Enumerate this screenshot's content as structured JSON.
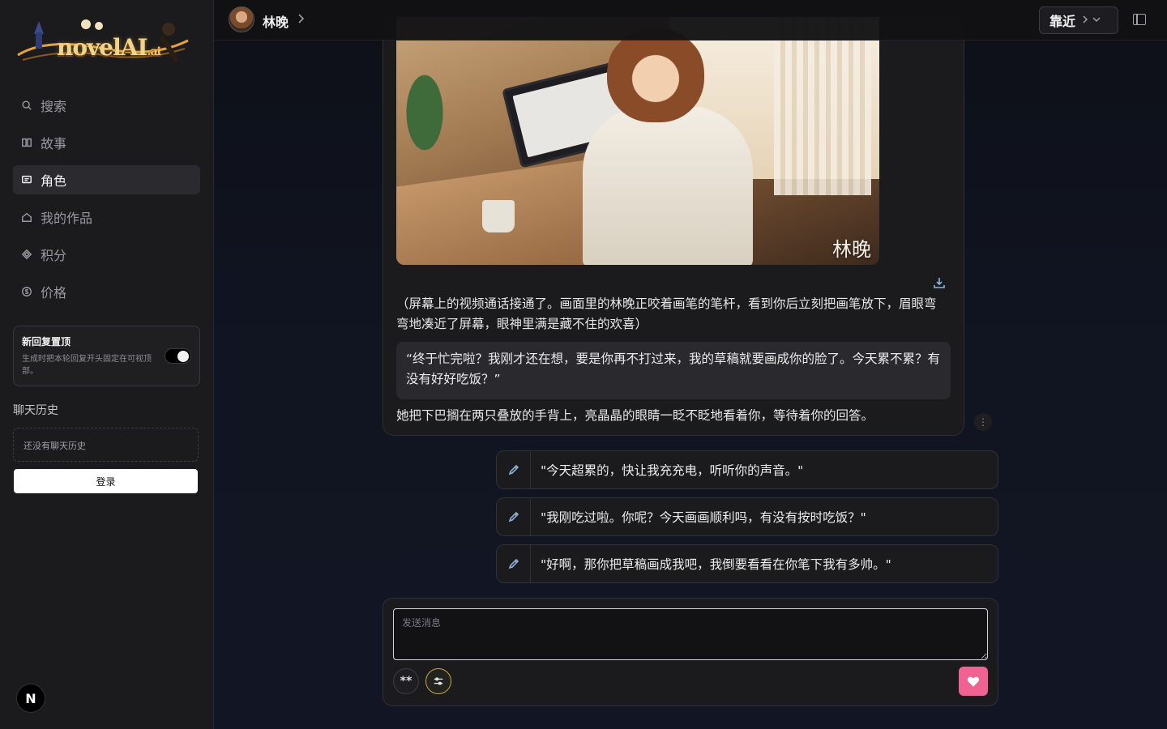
{
  "sidebar": {
    "logo_text": "novelAI",
    "logo_suffix": "ai",
    "nav": [
      {
        "label": "搜索",
        "icon": "search-icon"
      },
      {
        "label": "故事",
        "icon": "book-icon"
      },
      {
        "label": "角色",
        "icon": "chat-icon",
        "active": true
      },
      {
        "label": "我的作品",
        "icon": "home-icon"
      },
      {
        "label": "积分",
        "icon": "diamond-icon"
      },
      {
        "label": "价格",
        "icon": "dollar-icon"
      }
    ],
    "pin_card": {
      "title": "新回复置顶",
      "description": "生成时把本轮回复开头固定在可视顶部。",
      "toggle_on": true
    },
    "history_label": "聊天历史",
    "history_empty": "还没有聊天历史",
    "login_label": "登录",
    "badge": "N"
  },
  "header": {
    "character_name": "林晚",
    "sort_label": "靠近"
  },
  "message": {
    "image_caption": "林晚",
    "narration": "（屏幕上的视频通话接通了。画面里的林晚正咬着画笔的笔杆，看到你后立刻把画笔放下，眉眼弯弯地凑近了屏幕，眼神里满是藏不住的欢喜）",
    "quote": "“终于忙完啦？我刚才还在想，要是你再不打过来，我的草稿就要画成你的脸了。今天累不累？有没有好好吃饭？”",
    "closing": "她把下巴搁在两只叠放的手背上，亮晶晶的眼睛一眨不眨地看着你，等待着你的回答。"
  },
  "suggestions": [
    "\"今天超累的，快让我充充电，听听你的声音。\"",
    "\"我刚吃过啦。你呢？今天画画顺利吗，有没有按时吃饭？\"",
    "\"好啊，那你把草稿画成我吧，我倒要看看在你笔下我有多帅。\""
  ],
  "composer": {
    "placeholder": "发送消息",
    "stars_label": "**"
  },
  "colors": {
    "accent_pink": "#f06292",
    "accent_gold": "#c9a348",
    "icon_blue": "#8fb3d9"
  }
}
